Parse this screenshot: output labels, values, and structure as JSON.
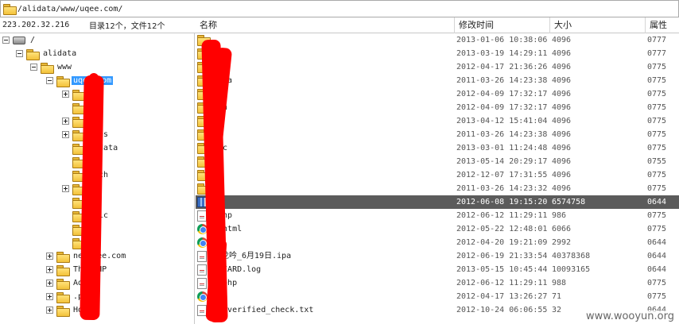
{
  "path": "/alidata/www/uqee.com/",
  "server_ip": "223.202.32.216",
  "summary": "目录12个，文件12个",
  "tree": [
    {
      "label": "/",
      "icon": "drive-icon",
      "expander": "minus",
      "selected": false
    },
    {
      "label": "alidata",
      "icon": "folder-icon",
      "expander": "minus",
      "selected": false
    },
    {
      "label": "www",
      "icon": "folder-icon",
      "expander": "minus",
      "selected": false
    },
    {
      "label": "uqee.com",
      "icon": "folder-icon",
      "expander": "minus",
      "selected": true
    },
    {
      "label": "",
      "icon": "folder-icon",
      "expander": "plus",
      "selected": false
    },
    {
      "label": "",
      "icon": "folder-icon",
      "expander": "",
      "selected": false
    },
    {
      "label": "",
      "icon": "folder-icon",
      "expander": "plus",
      "selected": false
    },
    {
      "label": "ages",
      "icon": "folder-icon",
      "expander": "plus",
      "selected": false
    },
    {
      "label": "stdata",
      "icon": "folder-icon",
      "expander": "",
      "selected": false
    },
    {
      "label": "",
      "icon": "folder-icon",
      "expander": "",
      "selected": false
    },
    {
      "label": "arch",
      "icon": "folder-icon",
      "expander": "",
      "selected": false
    },
    {
      "label": "y",
      "icon": "folder-icon",
      "expander": "plus",
      "selected": false
    },
    {
      "label": "in",
      "icon": "folder-icon",
      "expander": "",
      "selected": false
    },
    {
      "label": "blic",
      "icon": "folder-icon",
      "expander": "",
      "selected": false
    },
    {
      "label": "ta",
      "icon": "folder-icon",
      "expander": "",
      "selected": false
    },
    {
      "label": "",
      "icon": "folder-icon",
      "expander": "",
      "selected": false
    },
    {
      "label": "new qee.com",
      "icon": "folder-icon",
      "expander": "plus",
      "selected": false
    },
    {
      "label": "Thi PHP",
      "icon": "folder-icon",
      "expander": "plus",
      "selected": false
    },
    {
      "label": "Adm",
      "icon": "folder-icon",
      "expander": "plus",
      "selected": false
    },
    {
      "label": ".pk",
      "icon": "folder-icon",
      "expander": "plus",
      "selected": false
    },
    {
      "label": "Hom",
      "icon": "folder-icon",
      "expander": "plus",
      "selected": false
    }
  ],
  "columns": {
    "name": "名称",
    "modified": "修改时间",
    "size": "大小",
    "attr": "属性"
  },
  "files": [
    {
      "name": "",
      "icon": "folder-icon",
      "modified": "2013-01-06 10:38:06",
      "size": "4096",
      "attr": "0777",
      "selected": false
    },
    {
      "name": "",
      "icon": "folder-icon",
      "modified": "2013-03-19 14:29:11",
      "size": "4096",
      "attr": "0777",
      "selected": false
    },
    {
      "name": "ges",
      "icon": "folder-icon",
      "modified": "2012-04-17 21:36:26",
      "size": "4096",
      "attr": "0775",
      "selected": false
    },
    {
      "name": "data",
      "icon": "folder-icon",
      "modified": "2011-03-26 14:23:38",
      "size": "4096",
      "attr": "0775",
      "selected": false
    },
    {
      "name": "",
      "icon": "folder-icon",
      "modified": "2012-04-09 17:32:17",
      "size": "4096",
      "attr": "0775",
      "selected": false
    },
    {
      "name": "rch",
      "icon": "folder-icon",
      "modified": "2012-04-09 17:32:17",
      "size": "4096",
      "attr": "0775",
      "selected": false
    },
    {
      "name": "",
      "icon": "folder-icon",
      "modified": "2013-04-12 15:41:04",
      "size": "4096",
      "attr": "0775",
      "selected": false
    },
    {
      "name": "",
      "icon": "folder-icon",
      "modified": "2011-03-26 14:23:38",
      "size": "4096",
      "attr": "0775",
      "selected": false
    },
    {
      "name": "lic",
      "icon": "folder-icon",
      "modified": "2013-03-01 11:24:48",
      "size": "4096",
      "attr": "0775",
      "selected": false
    },
    {
      "name": "",
      "icon": "folder-icon",
      "modified": "2013-05-14 20:29:17",
      "size": "4096",
      "attr": "0755",
      "selected": false
    },
    {
      "name": "",
      "icon": "folder-icon",
      "modified": "2012-12-07 17:31:55",
      "size": "4096",
      "attr": "0775",
      "selected": false
    },
    {
      "name": "",
      "icon": "folder-icon",
      "modified": "2011-03-26 14:23:32",
      "size": "4096",
      "attr": "0775",
      "selected": false
    },
    {
      "name": "ar",
      "icon": "archive-icon",
      "modified": "2012-06-08 19:15:20",
      "size": "6574758",
      "attr": "0644",
      "selected": true
    },
    {
      "name": ".php",
      "icon": "file-icon",
      "modified": "2012-06-12 11:29:11",
      "size": "986",
      "attr": "0775",
      "selected": false
    },
    {
      "name": "r.html",
      "icon": "chrome-icon",
      "modified": "2012-05-22 12:48:01",
      "size": "6066",
      "attr": "0775",
      "selected": false
    },
    {
      "name": "tml",
      "icon": "chrome-icon",
      "modified": "2012-04-20 19:21:09",
      "size": "2992",
      "attr": "0644",
      "selected": false
    },
    {
      "name": "卧龙吟_6月19日.ipa",
      "icon": "file-icon",
      "modified": "2012-06-19 21:33:54",
      "size": "40378368",
      "attr": "0644",
      "selected": false
    },
    {
      "name": "y_CARD.log",
      "icon": "file-icon",
      "modified": "2013-05-15 10:45:44",
      "size": "10093165",
      "attr": "0644",
      "selected": false
    },
    {
      "name": "x.php",
      "icon": "file-icon",
      "modified": "2012-06-12 11:29:11",
      "size": "988",
      "attr": "0775",
      "selected": false
    },
    {
      "name": "htm",
      "icon": "chrome-icon",
      "modified": "2012-04-17 13:26:27",
      "size": "71",
      "attr": "0775",
      "selected": false
    },
    {
      "name": "na_verified_check.txt",
      "icon": "file-icon",
      "modified": "2012-10-24 06:06:55",
      "size": "32",
      "attr": "0644",
      "selected": false
    }
  ],
  "watermark": "www.wooyun.org",
  "colors": {
    "selection_tree": "#3399ff",
    "selection_list": "#5b5b5b",
    "redaction": "#ff0000",
    "folder": "#f3c23a"
  }
}
